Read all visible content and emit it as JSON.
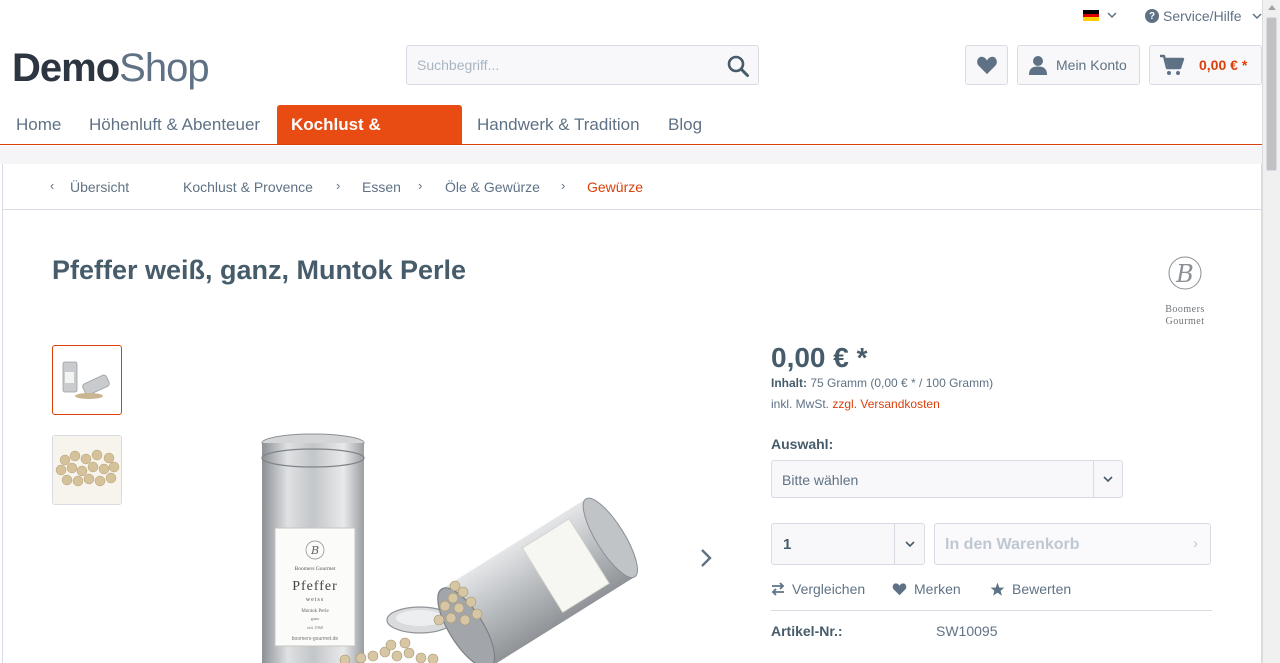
{
  "topbar": {
    "language": "de",
    "service_label": "Service/Hilfe"
  },
  "header": {
    "logo_bold": "Demo",
    "logo_light": "Shop",
    "search_placeholder": "Suchbegriff...",
    "account_label": "Mein Konto",
    "cart_amount": "0,00 € *"
  },
  "nav": {
    "items": [
      {
        "label": "Home"
      },
      {
        "label": "Höhenluft & Abenteuer"
      },
      {
        "label": "Kochlust & Provence",
        "active": true
      },
      {
        "label": "Handwerk & Tradition"
      },
      {
        "label": "Blog"
      }
    ]
  },
  "breadcrumb": {
    "back_label": "Übersicht",
    "items": [
      {
        "label": "Kochlust & Provence"
      },
      {
        "label": "Essen"
      },
      {
        "label": "Öle & Gewürze"
      },
      {
        "label": "Gewürze"
      }
    ]
  },
  "product": {
    "title": "Pfeffer weiß, ganz, Muntok Perle",
    "brand_lines": [
      "Boomers",
      "Gourmet"
    ],
    "brand_monogram": "B",
    "tin_label": {
      "brand": "Boomers Gourmet",
      "name": "Pfeffer",
      "subname": "weiss",
      "variety": "Muntok Perle",
      "form": "ganz",
      "since": "seit 1960",
      "web": "boomers-gourmet.de"
    },
    "price": "0,00 € *",
    "content_label": "Inhalt:",
    "content_value": "75 Gramm (0,00 € * / 100 Gramm)",
    "tax_text": "inkl. MwSt.",
    "shipping_link": "zzgl. Versandkosten",
    "select_label": "Auswahl:",
    "select_value": "Bitte wählen",
    "quantity": "1",
    "add_to_cart": "In den Warenkorb",
    "actions": {
      "compare": "Vergleichen",
      "wishlist": "Merken",
      "rate": "Bewerten"
    },
    "sku_label": "Artikel-Nr.:",
    "sku_value": "SW10095"
  },
  "colors": {
    "accent": "#e84c13",
    "accent_text": "#d9400b",
    "text": "#5f7285",
    "heading": "#475c6a",
    "border": "#dadae5"
  }
}
